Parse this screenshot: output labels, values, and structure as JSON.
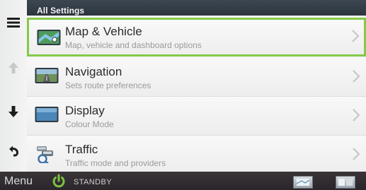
{
  "header": {
    "title": "All Settings"
  },
  "rail": {
    "menu_icon": "hamburger-menu-icon",
    "up_icon": "arrow-up-icon",
    "down_icon": "arrow-down-icon",
    "back_icon": "back-arrow-icon"
  },
  "settings": {
    "items": [
      {
        "title": "Map & Vehicle",
        "subtitle": "Map, vehicle and dashboard options",
        "icon": "map-vehicle-icon",
        "selected": true
      },
      {
        "title": "Navigation",
        "subtitle": "Sets route preferences",
        "icon": "navigation-road-icon",
        "selected": false
      },
      {
        "title": "Display",
        "subtitle": "Colour Mode",
        "icon": "display-screen-icon",
        "selected": false
      },
      {
        "title": "Traffic",
        "subtitle": "Traffic mode and providers",
        "icon": "traffic-icon",
        "selected": false
      }
    ]
  },
  "bottom_bar": {
    "menu_label": "Menu",
    "standby_label": "STANDBY"
  },
  "colors": {
    "selection_border": "#86c94a",
    "header_bg": "#33404a",
    "list_bg": "#f3f3f3"
  }
}
